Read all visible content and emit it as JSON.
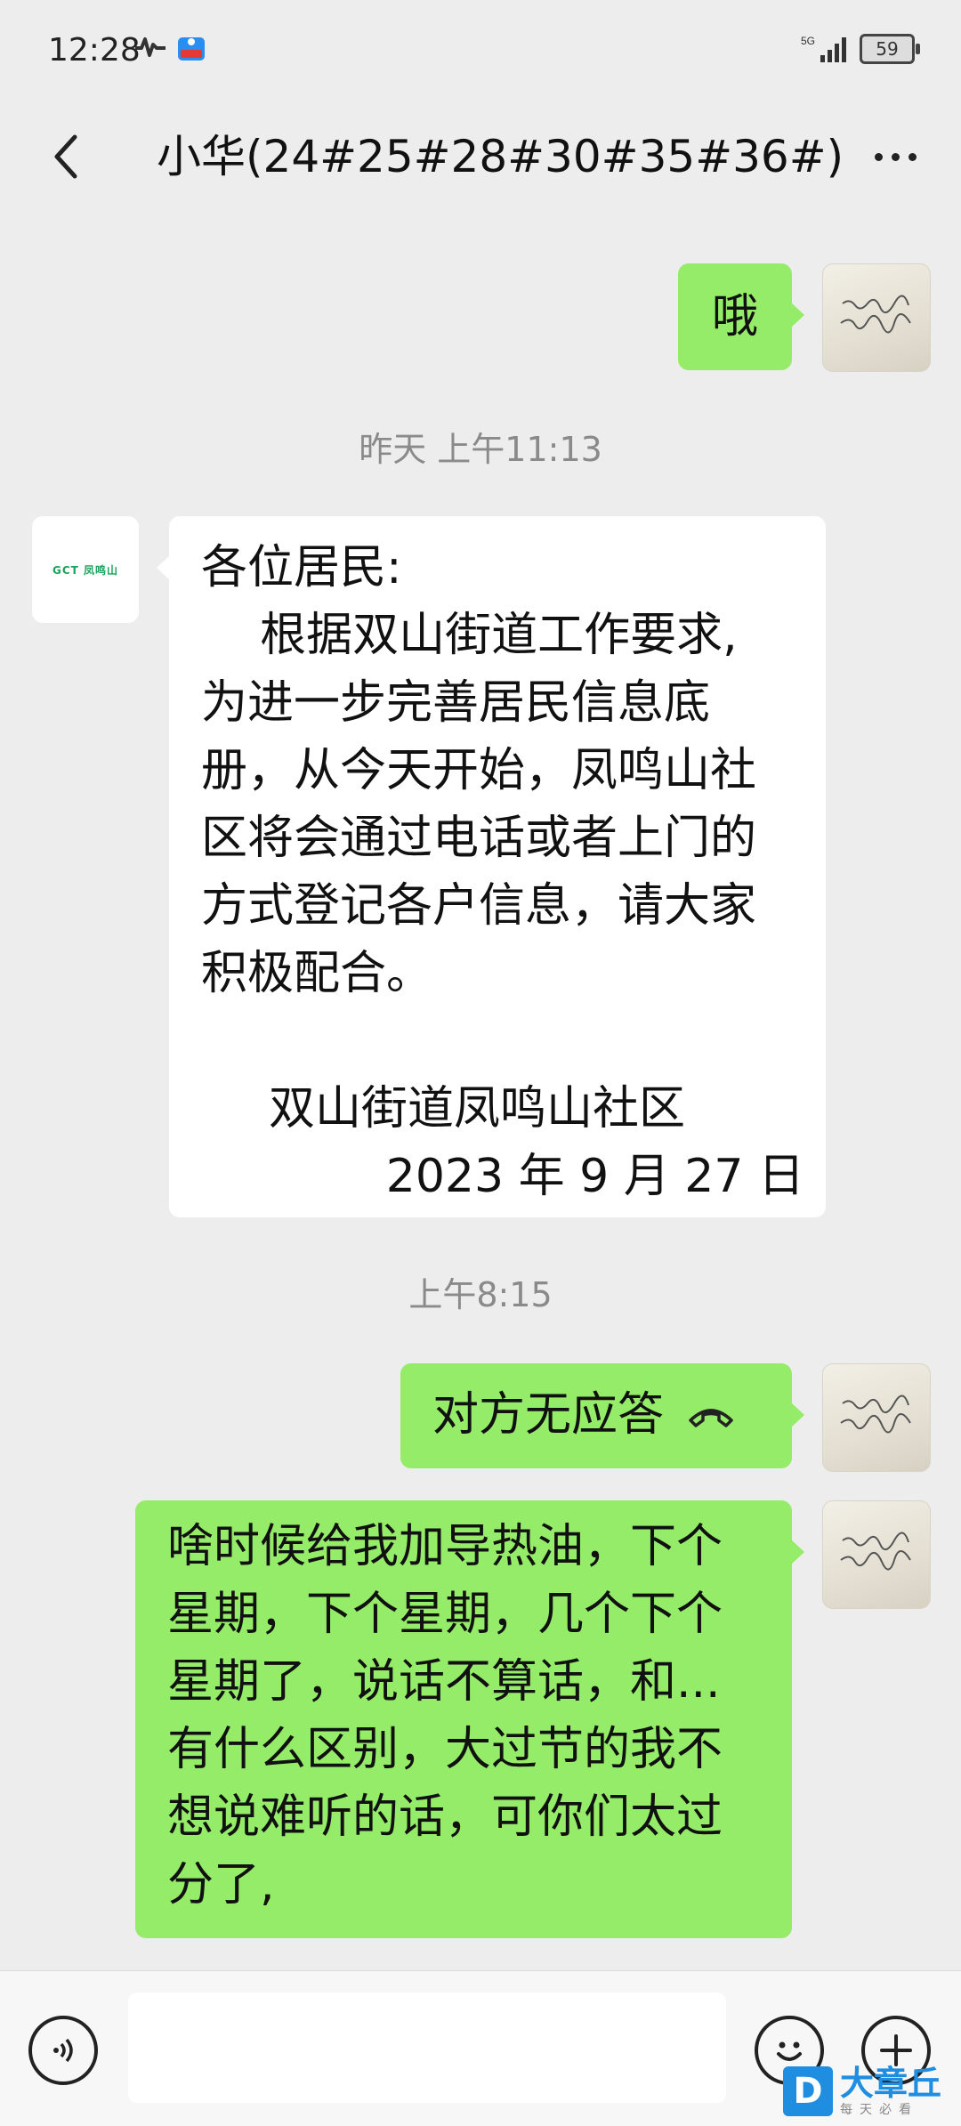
{
  "status_bar": {
    "time": "12:28",
    "signal": "5G",
    "battery": "59"
  },
  "header": {
    "title": "小华(24#25#28#30#35#36#)"
  },
  "messages": {
    "m1": {
      "text": "哦"
    },
    "ts1": "昨天 上午11:13",
    "notice": {
      "lines": [
        "各位居民:",
        "    根据双山街道工作要求,",
        "为进一步完善居民信息底",
        "册，从今天开始，凤鸣山社",
        "区将会通过电话或者上门的",
        "方式登记各户信息，请大家",
        "积极配合。"
      ],
      "sign_org": "双山街道凤鸣山社区",
      "sign_date": "2023 年 9 月 27 日"
    },
    "ts2": "上午8:15",
    "call": {
      "text": "对方无应答"
    },
    "m3": {
      "lines": [
        "啥时候给我加导热油，下个",
        "星期，下个星期，几个下个",
        "星期了，说话不算话，和...",
        "有什么区别，大过节的我不",
        "想说难听的话，可你们太过",
        "分了,"
      ]
    }
  },
  "org_avatar": {
    "logo_text": "GCT 凤鸣山"
  },
  "watermark": {
    "logo": "D",
    "main": "大章丘",
    "sub": "每天必看"
  },
  "colors": {
    "bubble_self": "#95ec69",
    "bubble_other": "#ffffff",
    "background": "#ededed"
  }
}
